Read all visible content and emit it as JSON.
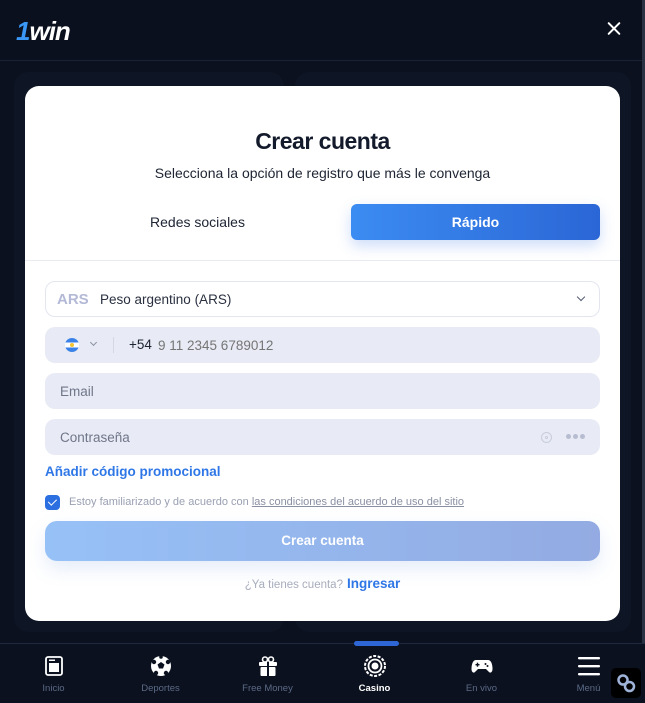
{
  "header": {
    "logo_one": "1",
    "logo_text": "win"
  },
  "modal": {
    "title": "Crear cuenta",
    "subtitle": "Selecciona la opción de registro que más le convenga",
    "tabs": [
      {
        "label": "Redes sociales",
        "active": false
      },
      {
        "label": "Rápido",
        "active": true
      }
    ],
    "currency": {
      "code": "ARS",
      "name": "Peso argentino (ARS)"
    },
    "phone": {
      "country": "Argentina",
      "prefix": "+54",
      "placeholder": "9 11 2345 6789012"
    },
    "email": {
      "placeholder": "Email"
    },
    "password": {
      "placeholder": "Contraseña"
    },
    "promo_link": "Añadir código promocional",
    "terms": {
      "checked": true,
      "text": "Estoy familiarizado y de acuerdo con ",
      "link": "las condiciones del acuerdo de uso del sitio"
    },
    "submit_label": "Crear cuenta",
    "login_prompt": "¿Ya tienes cuenta?",
    "login_link": "Ingresar"
  },
  "bottom_nav": [
    {
      "label": "Inicio",
      "icon": "home-icon",
      "active": false
    },
    {
      "label": "Deportes",
      "icon": "soccer-ball-icon",
      "active": false
    },
    {
      "label": "Free Money",
      "icon": "gift-icon",
      "active": false
    },
    {
      "label": "Casino",
      "icon": "casino-chip-icon",
      "active": true
    },
    {
      "label": "En vivo",
      "icon": "gamepad-icon",
      "active": false
    },
    {
      "label": "Menú",
      "icon": "menu-icon",
      "active": false
    }
  ],
  "colors": {
    "accent": "#2f77e6",
    "background": "#0b111e",
    "active_indicator": "#2f66d6"
  }
}
